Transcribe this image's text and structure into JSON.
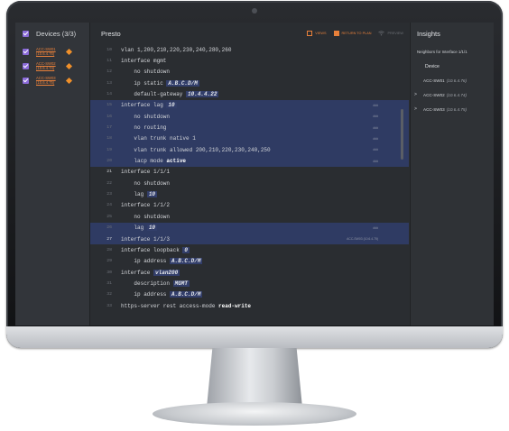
{
  "left_panel": {
    "title": "Devices (3/3)",
    "devices": [
      {
        "name": "ACC-SW01 (10.6.4.76)"
      },
      {
        "name": "ACC-SW02 (10.6.4.74)"
      },
      {
        "name": "ACC-SW03 (10.6.4.75)"
      }
    ]
  },
  "editor": {
    "title": "Presto",
    "buttons": {
      "view": "VIEWS",
      "return": "RETURN TO PLAN",
      "preview": "PREVIEW"
    },
    "lines": [
      {
        "num": "10",
        "text": "vlan 1,200,210,220,230,240,280,260",
        "kw": ""
      },
      {
        "num": "11",
        "text": "interface mgmt",
        "kw": ""
      },
      {
        "num": "12",
        "text": "    no shutdown",
        "kw": ""
      },
      {
        "num": "13",
        "text": "    ip static ",
        "kw": "A.B.C.D/M"
      },
      {
        "num": "14",
        "text": "    default-gateway ",
        "kw": "10.4.4.22"
      },
      {
        "num": "15",
        "text": "interface lag ",
        "kw": "10",
        "tag": "###"
      },
      {
        "num": "16",
        "text": "    no shutdown",
        "kw": "",
        "tag": "###"
      },
      {
        "num": "17",
        "text": "    no routing",
        "kw": "",
        "tag": "###"
      },
      {
        "num": "18",
        "text": "    vlan trunk native 1",
        "kw": "",
        "tag": "###"
      },
      {
        "num": "19",
        "text": "    vlan trunk allowed 200,210,220,230,240,250",
        "kw": "",
        "tag": "###"
      },
      {
        "num": "20",
        "text": "    lacp mode ",
        "kw": "active",
        "tag": "###"
      },
      {
        "num": "21",
        "text": "interface 1/1/1",
        "kw": ""
      },
      {
        "num": "22",
        "text": "    no shutdown",
        "kw": ""
      },
      {
        "num": "23",
        "text": "    lag ",
        "kw": "10"
      },
      {
        "num": "24",
        "text": "interface 1/1/2",
        "kw": ""
      },
      {
        "num": "25",
        "text": "    no shutdown",
        "kw": ""
      },
      {
        "num": "26",
        "text": "    lag ",
        "kw": "10",
        "tag": "###"
      },
      {
        "num": "27",
        "text": "interface 1/1/3",
        "kw": "",
        "tag": "ACC-SW03 (10.6.4.75)"
      },
      {
        "num": "28",
        "text": "interface loopback ",
        "kw": "0"
      },
      {
        "num": "29",
        "text": "    ip address ",
        "kw": "A.B.C.D/M"
      },
      {
        "num": "30",
        "text": "interface ",
        "kw": "vlan200"
      },
      {
        "num": "31",
        "text": "    description ",
        "kw": "MGMT"
      },
      {
        "num": "32",
        "text": "    ip address ",
        "kw": "A.B.C.D/M"
      },
      {
        "num": "33",
        "text": "https-server rest access-mode ",
        "kw": "read-write"
      }
    ]
  },
  "insights": {
    "title": "Insights",
    "subtitle": "Neighbors for Interface 1/1/1",
    "column": "Device",
    "rows": [
      {
        "name": "ACC-SW01",
        "ip": "(10.6.4.76)"
      },
      {
        "name": "ACC-SW02",
        "ip": "(10.6.4.74)"
      },
      {
        "name": "ACC-SW03",
        "ip": "(10.6.4.75)"
      }
    ]
  },
  "colors": {
    "accent": "#e8803a",
    "checkbox": "#8a6ad8",
    "highlight": "#2f3b63"
  }
}
